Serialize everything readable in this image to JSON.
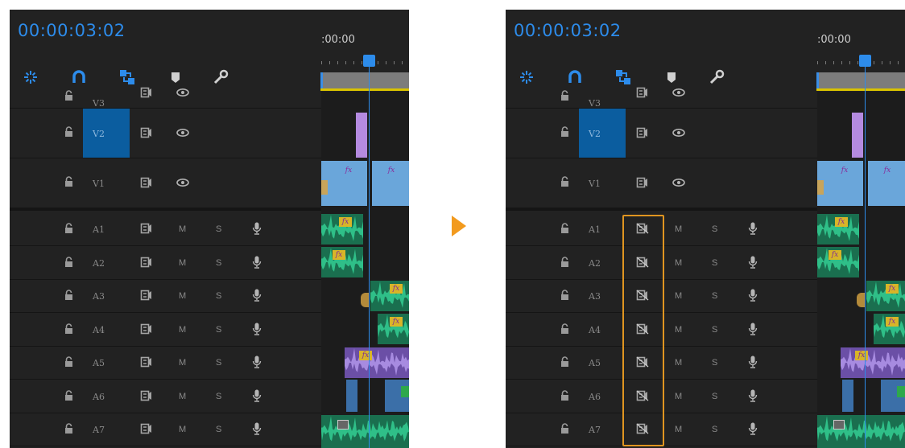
{
  "left": {
    "timecode": "00:00:03:02",
    "ruler_time": ":00:00",
    "video_tracks": [
      {
        "name": "V3"
      },
      {
        "name": "V2"
      },
      {
        "name": "V1"
      }
    ],
    "audio_tracks": [
      {
        "name": "A1",
        "m": "M",
        "s": "S"
      },
      {
        "name": "A2",
        "m": "M",
        "s": "S"
      },
      {
        "name": "A3",
        "m": "M",
        "s": "S"
      },
      {
        "name": "A4",
        "m": "M",
        "s": "S"
      },
      {
        "name": "A5",
        "m": "M",
        "s": "S"
      },
      {
        "name": "A6",
        "m": "M",
        "s": "S"
      },
      {
        "name": "A7",
        "m": "M",
        "s": "S"
      }
    ],
    "fx_label": "fx"
  },
  "right": {
    "timecode": "00:00:03:02",
    "ruler_time": ":00:00",
    "video_tracks": [
      {
        "name": "V3"
      },
      {
        "name": "V2"
      },
      {
        "name": "V1"
      }
    ],
    "audio_tracks": [
      {
        "name": "A1",
        "m": "M",
        "s": "S"
      },
      {
        "name": "A2",
        "m": "M",
        "s": "S"
      },
      {
        "name": "A3",
        "m": "M",
        "s": "S"
      },
      {
        "name": "A4",
        "m": "M",
        "s": "S"
      },
      {
        "name": "A5",
        "m": "M",
        "s": "S"
      },
      {
        "name": "A6",
        "m": "M",
        "s": "S"
      },
      {
        "name": "A7",
        "m": "M",
        "s": "S"
      }
    ],
    "fx_label": "fx"
  },
  "colors": {
    "accent": "#2d8ceb",
    "highlight": "#e09520",
    "arrow": "#f29a1e",
    "selected_track": "#0b5d9f",
    "audio_clip": "#1f9a6e",
    "video_clip": "#6aa6da",
    "adjustment_clip": "#b48ae0"
  },
  "icons": [
    "snap-icon",
    "magnet-icon",
    "linked-selection-icon",
    "marker-icon",
    "wrench-icon",
    "lock-icon",
    "sync-lock-icon",
    "eye-icon",
    "mic-icon"
  ]
}
